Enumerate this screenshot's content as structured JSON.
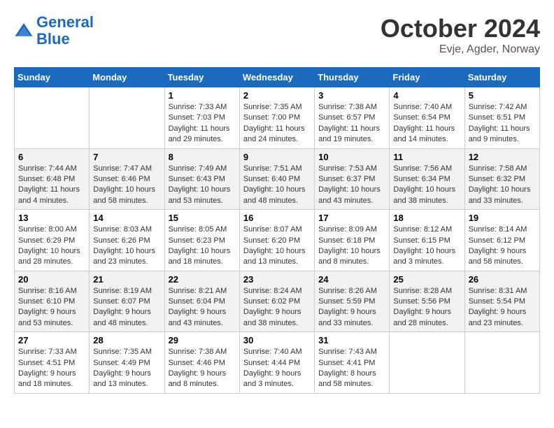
{
  "header": {
    "logo_line1": "General",
    "logo_line2": "Blue",
    "month": "October 2024",
    "location": "Evje, Agder, Norway"
  },
  "weekdays": [
    "Sunday",
    "Monday",
    "Tuesday",
    "Wednesday",
    "Thursday",
    "Friday",
    "Saturday"
  ],
  "weeks": [
    [
      {
        "day": "",
        "info": ""
      },
      {
        "day": "",
        "info": ""
      },
      {
        "day": "1",
        "info": "Sunrise: 7:33 AM\nSunset: 7:03 PM\nDaylight: 11 hours and 29 minutes."
      },
      {
        "day": "2",
        "info": "Sunrise: 7:35 AM\nSunset: 7:00 PM\nDaylight: 11 hours and 24 minutes."
      },
      {
        "day": "3",
        "info": "Sunrise: 7:38 AM\nSunset: 6:57 PM\nDaylight: 11 hours and 19 minutes."
      },
      {
        "day": "4",
        "info": "Sunrise: 7:40 AM\nSunset: 6:54 PM\nDaylight: 11 hours and 14 minutes."
      },
      {
        "day": "5",
        "info": "Sunrise: 7:42 AM\nSunset: 6:51 PM\nDaylight: 11 hours and 9 minutes."
      }
    ],
    [
      {
        "day": "6",
        "info": "Sunrise: 7:44 AM\nSunset: 6:48 PM\nDaylight: 11 hours and 4 minutes."
      },
      {
        "day": "7",
        "info": "Sunrise: 7:47 AM\nSunset: 6:46 PM\nDaylight: 10 hours and 58 minutes."
      },
      {
        "day": "8",
        "info": "Sunrise: 7:49 AM\nSunset: 6:43 PM\nDaylight: 10 hours and 53 minutes."
      },
      {
        "day": "9",
        "info": "Sunrise: 7:51 AM\nSunset: 6:40 PM\nDaylight: 10 hours and 48 minutes."
      },
      {
        "day": "10",
        "info": "Sunrise: 7:53 AM\nSunset: 6:37 PM\nDaylight: 10 hours and 43 minutes."
      },
      {
        "day": "11",
        "info": "Sunrise: 7:56 AM\nSunset: 6:34 PM\nDaylight: 10 hours and 38 minutes."
      },
      {
        "day": "12",
        "info": "Sunrise: 7:58 AM\nSunset: 6:32 PM\nDaylight: 10 hours and 33 minutes."
      }
    ],
    [
      {
        "day": "13",
        "info": "Sunrise: 8:00 AM\nSunset: 6:29 PM\nDaylight: 10 hours and 28 minutes."
      },
      {
        "day": "14",
        "info": "Sunrise: 8:03 AM\nSunset: 6:26 PM\nDaylight: 10 hours and 23 minutes."
      },
      {
        "day": "15",
        "info": "Sunrise: 8:05 AM\nSunset: 6:23 PM\nDaylight: 10 hours and 18 minutes."
      },
      {
        "day": "16",
        "info": "Sunrise: 8:07 AM\nSunset: 6:20 PM\nDaylight: 10 hours and 13 minutes."
      },
      {
        "day": "17",
        "info": "Sunrise: 8:09 AM\nSunset: 6:18 PM\nDaylight: 10 hours and 8 minutes."
      },
      {
        "day": "18",
        "info": "Sunrise: 8:12 AM\nSunset: 6:15 PM\nDaylight: 10 hours and 3 minutes."
      },
      {
        "day": "19",
        "info": "Sunrise: 8:14 AM\nSunset: 6:12 PM\nDaylight: 9 hours and 58 minutes."
      }
    ],
    [
      {
        "day": "20",
        "info": "Sunrise: 8:16 AM\nSunset: 6:10 PM\nDaylight: 9 hours and 53 minutes."
      },
      {
        "day": "21",
        "info": "Sunrise: 8:19 AM\nSunset: 6:07 PM\nDaylight: 9 hours and 48 minutes."
      },
      {
        "day": "22",
        "info": "Sunrise: 8:21 AM\nSunset: 6:04 PM\nDaylight: 9 hours and 43 minutes."
      },
      {
        "day": "23",
        "info": "Sunrise: 8:24 AM\nSunset: 6:02 PM\nDaylight: 9 hours and 38 minutes."
      },
      {
        "day": "24",
        "info": "Sunrise: 8:26 AM\nSunset: 5:59 PM\nDaylight: 9 hours and 33 minutes."
      },
      {
        "day": "25",
        "info": "Sunrise: 8:28 AM\nSunset: 5:56 PM\nDaylight: 9 hours and 28 minutes."
      },
      {
        "day": "26",
        "info": "Sunrise: 8:31 AM\nSunset: 5:54 PM\nDaylight: 9 hours and 23 minutes."
      }
    ],
    [
      {
        "day": "27",
        "info": "Sunrise: 7:33 AM\nSunset: 4:51 PM\nDaylight: 9 hours and 18 minutes."
      },
      {
        "day": "28",
        "info": "Sunrise: 7:35 AM\nSunset: 4:49 PM\nDaylight: 9 hours and 13 minutes."
      },
      {
        "day": "29",
        "info": "Sunrise: 7:38 AM\nSunset: 4:46 PM\nDaylight: 9 hours and 8 minutes."
      },
      {
        "day": "30",
        "info": "Sunrise: 7:40 AM\nSunset: 4:44 PM\nDaylight: 9 hours and 3 minutes."
      },
      {
        "day": "31",
        "info": "Sunrise: 7:43 AM\nSunset: 4:41 PM\nDaylight: 8 hours and 58 minutes."
      },
      {
        "day": "",
        "info": ""
      },
      {
        "day": "",
        "info": ""
      }
    ]
  ]
}
